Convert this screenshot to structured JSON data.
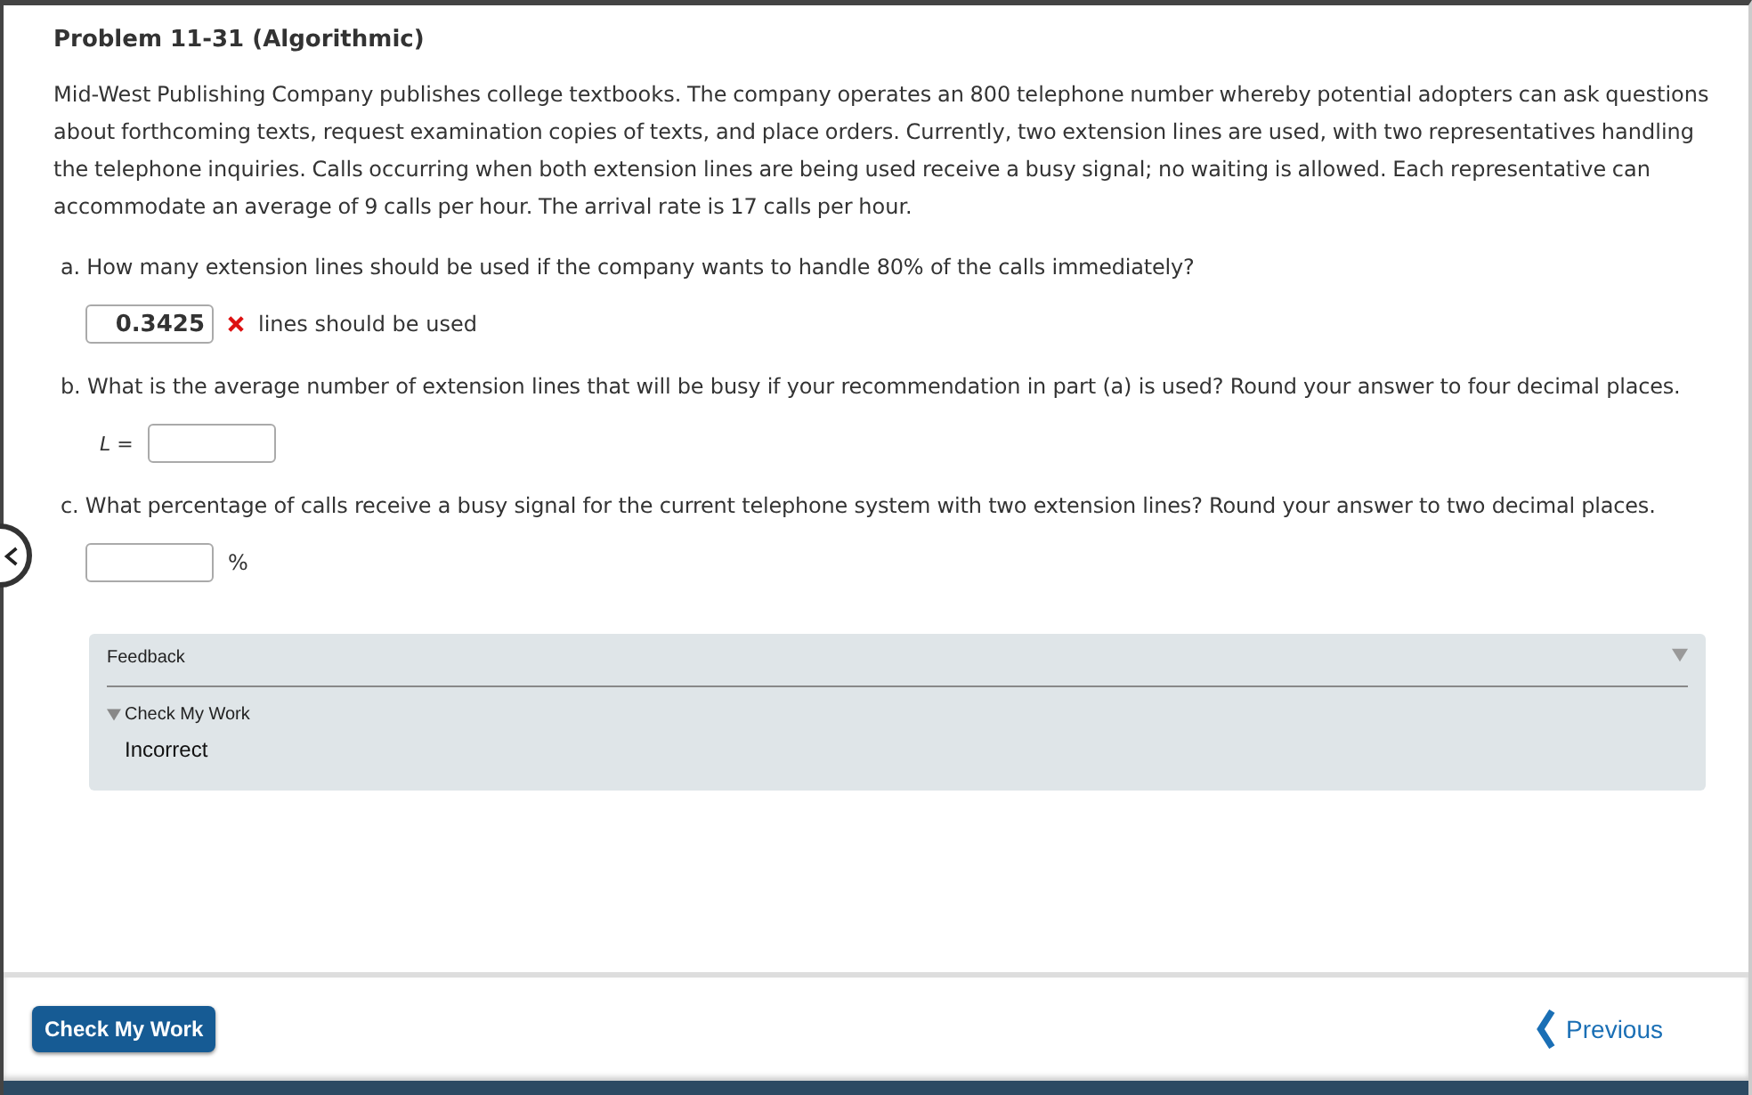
{
  "title": "Problem 11-31 (Algorithmic)",
  "intro": "Mid-West Publishing Company publishes college textbooks. The company operates an 800 telephone number whereby potential adopters can ask questions about forthcoming texts, request examination copies of texts, and place orders. Currently, two extension lines are used, with two representatives handling the telephone inquiries. Calls occurring when both extension lines are being used receive a busy signal; no waiting is allowed. Each representative can accommodate an average of 9 calls per hour. The arrival rate is 17 calls per hour.",
  "parts": [
    {
      "question": "a. How many extension lines should be used if the company wants to handle 80% of the calls immediately?",
      "value": "0.3425",
      "incorrect": true,
      "suffix": "lines should be used"
    },
    {
      "question": "b. What is the average number of extension lines that will be busy if your recommendation in part (a) is used? Round your answer to four decimal places.",
      "prefix": "L ="
    },
    {
      "question": "c. What percentage of calls receive a busy signal for the current telephone system with two extension lines? Round your answer to two decimal places.",
      "suffix": "%"
    }
  ],
  "feedback": {
    "title": "Feedback",
    "section": {
      "title": "Check My Work",
      "expanded": true,
      "result": "Incorrect"
    }
  },
  "footer": {
    "check_button": "Check My Work",
    "previous": "Previous"
  }
}
